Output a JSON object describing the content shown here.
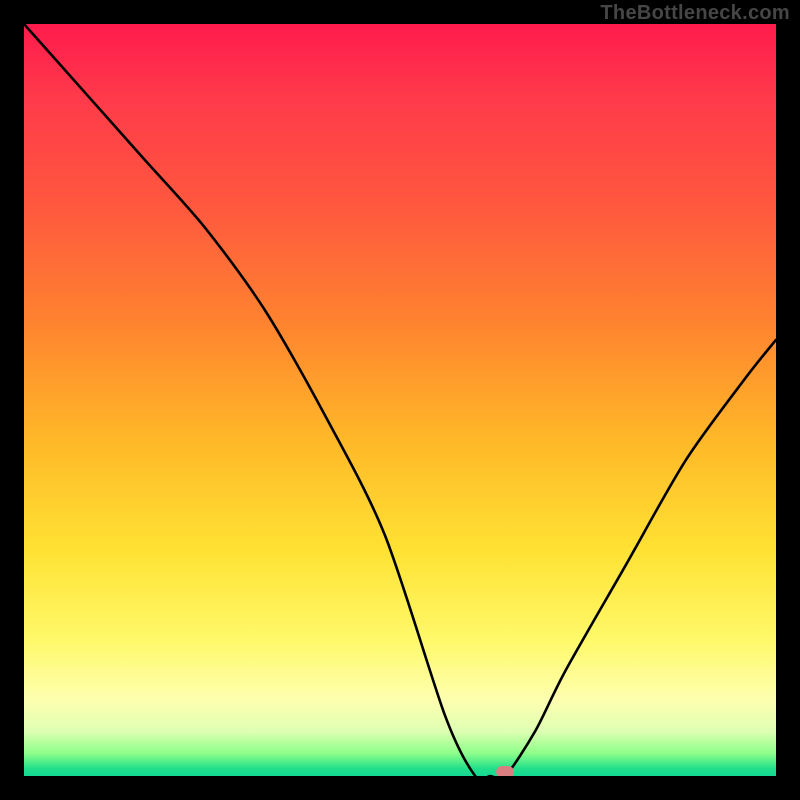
{
  "watermark": "TheBottleneck.com",
  "chart_data": {
    "type": "line",
    "title": "",
    "xlabel": "",
    "ylabel": "",
    "xlim": [
      0,
      100
    ],
    "ylim": [
      0,
      100
    ],
    "x": [
      0,
      8,
      16,
      24,
      32,
      40,
      48,
      56,
      60,
      62,
      64,
      68,
      72,
      80,
      88,
      96,
      100
    ],
    "values": [
      100,
      91,
      82,
      73,
      62,
      48,
      32,
      8,
      0,
      0,
      0,
      6,
      14,
      28,
      42,
      53,
      58
    ],
    "marker": {
      "x": 64,
      "y": 0
    },
    "gradient_stops": [
      {
        "pos": 0,
        "color": "#ff1b4d"
      },
      {
        "pos": 10,
        "color": "#ff3a4a"
      },
      {
        "pos": 25,
        "color": "#ff5a3e"
      },
      {
        "pos": 40,
        "color": "#ff842f"
      },
      {
        "pos": 55,
        "color": "#ffb728"
      },
      {
        "pos": 70,
        "color": "#ffe233"
      },
      {
        "pos": 82,
        "color": "#fff96a"
      },
      {
        "pos": 90,
        "color": "#fdffb0"
      },
      {
        "pos": 94,
        "color": "#dfffb2"
      },
      {
        "pos": 97,
        "color": "#8dff8a"
      },
      {
        "pos": 99,
        "color": "#22e08a"
      },
      {
        "pos": 100,
        "color": "#14d994"
      }
    ]
  }
}
